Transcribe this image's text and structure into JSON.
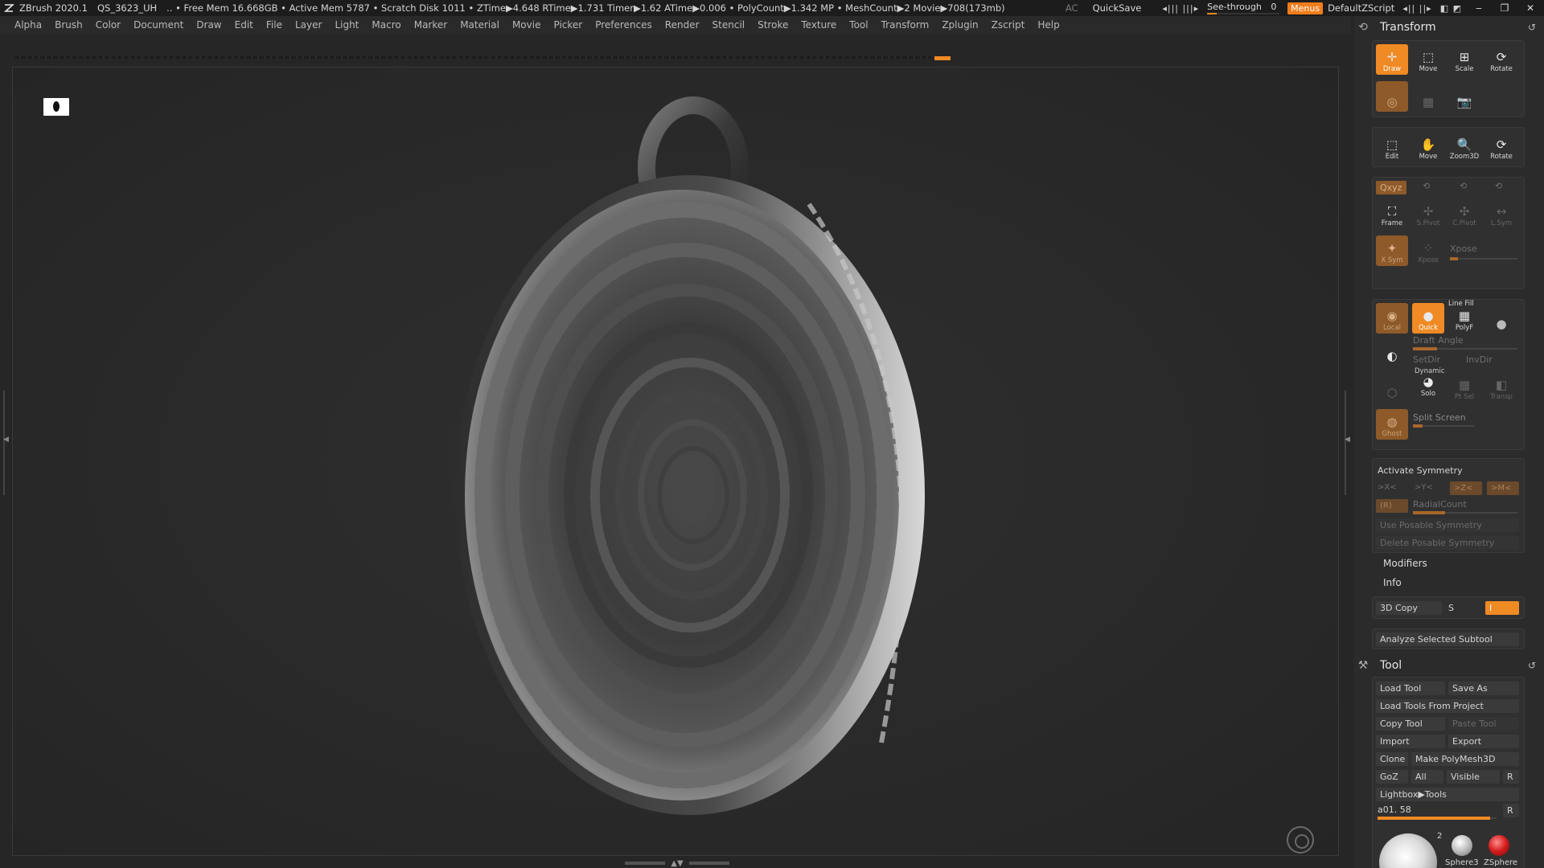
{
  "titlebar": {
    "app": "ZBrush 2020.1",
    "doc": "QS_3623_UH",
    "stats": ".. • Free Mem 16.668GB • Active Mem 5787 • Scratch Disk 1011 • ZTime▶4.648 RTime▶1.731 Timer▶1.62 ATime▶0.006 • PolyCount▶1.342 MP  • MeshCount▶2  Movie▶708(173mb)",
    "ac": "AC",
    "quicksave": "QuickSave",
    "see_through_label": "See-through",
    "see_through_value": "0",
    "menus": "Menus",
    "zscript": "DefaultZScript"
  },
  "menubar": [
    "Alpha",
    "Brush",
    "Color",
    "Document",
    "Draw",
    "Edit",
    "File",
    "Layer",
    "Light",
    "Macro",
    "Marker",
    "Material",
    "Movie",
    "Picker",
    "Preferences",
    "Render",
    "Stencil",
    "Stroke",
    "Texture",
    "Tool",
    "Transform",
    "Zplugin",
    "Zscript",
    "Help"
  ],
  "transform": {
    "title": "Transform",
    "tools1": [
      {
        "label": "Draw",
        "icon": "draw-icon"
      },
      {
        "label": "Move",
        "icon": "move-icon"
      },
      {
        "label": "Scale",
        "icon": "scale-icon"
      },
      {
        "label": "Rotate",
        "icon": "rotate-icon"
      }
    ],
    "tools2": [
      "Edit",
      "Move",
      "Zoom3D",
      "Rotate"
    ],
    "xyz": "Qxyz",
    "frame": "Frame",
    "spivot": "S.Pivot",
    "cpivot": "C.Pivot",
    "lsym": "L.Sym",
    "xsym": "X Sym",
    "xpose": "Xpose",
    "xpose_label": "Xpose",
    "local": "Local",
    "quick": "Quick",
    "linefill": "Line Fill",
    "polyf": "PolyF",
    "draft_angle": "Draft Angle",
    "setdir": "SetDir",
    "invdir": "InvDir",
    "dynamic": "Dynamic",
    "solo": "Solo",
    "ptsel": "Pt Sel",
    "transp": "Transp",
    "split_screen": "Split Screen",
    "ghost": "Ghost",
    "activate_symmetry": "Activate Symmetry",
    "sym_x": ">X<",
    "sym_y": ">Y<",
    "sym_z": ">Z<",
    "sym_m": ">M<",
    "sym_r": "(R)",
    "radialcount": "RadialCount",
    "use_posable": "Use Posable Symmetry",
    "delete_posable": "Delete Posable Symmetry",
    "modifiers": "Modifiers",
    "info": "Info",
    "copy3d": "3D Copy",
    "copy_s": "S",
    "copy_i": "I",
    "analyze": "Analyze Selected Subtool"
  },
  "tool": {
    "title": "Tool",
    "load_tool": "Load Tool",
    "save_as": "Save As",
    "load_from_project": "Load Tools From Project",
    "copy_tool": "Copy Tool",
    "paste_tool": "Paste Tool",
    "import": "Import",
    "export": "Export",
    "clone": "Clone",
    "make_polymesh": "Make PolyMesh3D",
    "goz": "GoZ",
    "all": "All",
    "visible": "Visible",
    "r": "R",
    "lightbox": "Lightbox▶Tools",
    "current": "a01. 58",
    "current_r": "R",
    "thumb_count": "2",
    "sphere3": "Sphere3",
    "zsphere": "ZSphere"
  },
  "colors": {
    "accent": "#f08a24",
    "panel": "#2b2b2b",
    "canvas": "#2b2b2b"
  }
}
